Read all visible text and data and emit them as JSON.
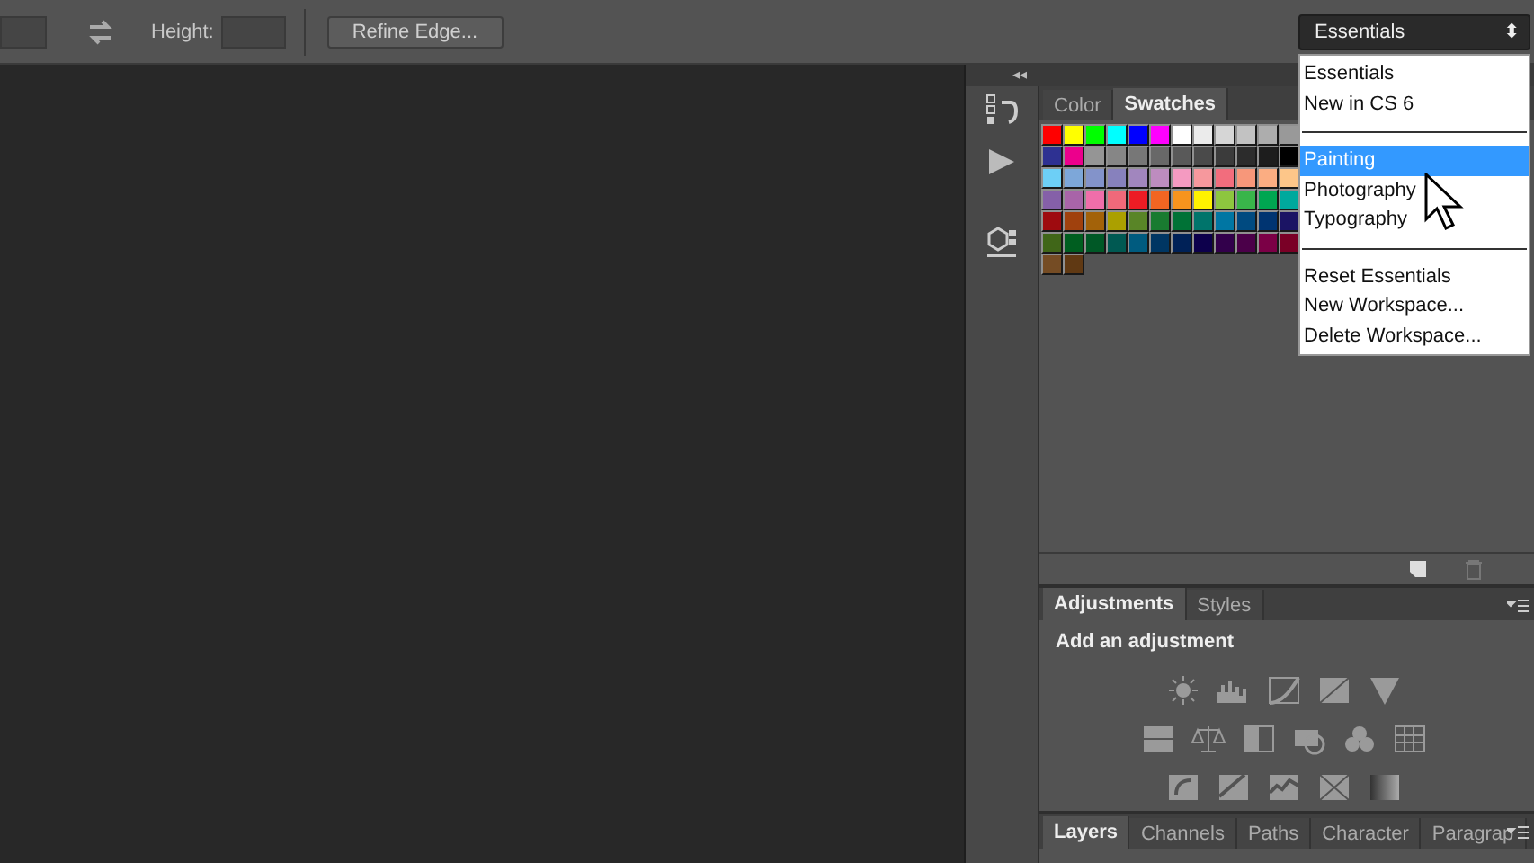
{
  "options_bar": {
    "height_label": "Height:",
    "refine_button": "Refine Edge...",
    "workspace_select": {
      "value": "Essentials",
      "arrow": "⬍"
    }
  },
  "dock": {
    "collapse": "◂◂"
  },
  "swatches_panel": {
    "tabs": [
      {
        "label": "Color",
        "selected": false
      },
      {
        "label": "Swatches",
        "selected": true
      }
    ],
    "rows": [
      {
        "swatches": [
          {
            "color": "#ff0000"
          },
          {
            "color": "#ffff00"
          },
          {
            "color": "#00ff00"
          },
          {
            "color": "#00ffff"
          },
          {
            "color": "#0000ff"
          },
          {
            "color": "#ff00ff"
          },
          {
            "color": "#ffffff"
          },
          {
            "color": "#ebebeb"
          },
          {
            "color": "#d6d6d6"
          },
          {
            "color": "#c2c2c2"
          },
          {
            "color": "#adadad"
          },
          {
            "color": "#999999"
          }
        ]
      },
      {
        "swatches": [
          {
            "color": "#2e3192"
          },
          {
            "color": "#ec008c"
          },
          {
            "color": "#959595"
          },
          {
            "color": "#868686"
          },
          {
            "color": "#777777"
          },
          {
            "color": "#686868"
          },
          {
            "color": "#595959"
          },
          {
            "color": "#4a4a4a"
          },
          {
            "color": "#3b3b3b"
          },
          {
            "color": "#2c2c2c"
          },
          {
            "color": "#1d1d1d"
          },
          {
            "color": "#000000"
          }
        ]
      },
      {
        "swatches": [
          {
            "color": "#6dcff6"
          },
          {
            "color": "#7da7d9"
          },
          {
            "color": "#8393ca"
          },
          {
            "color": "#8781bd"
          },
          {
            "color": "#a186be"
          },
          {
            "color": "#bd8cbf"
          },
          {
            "color": "#f49ac1"
          },
          {
            "color": "#f6989d"
          },
          {
            "color": "#f26d7d"
          },
          {
            "color": "#f7977a"
          },
          {
            "color": "#fbad82"
          },
          {
            "color": "#fdc689"
          }
        ]
      },
      {
        "swatches": [
          {
            "color": "#8560a8"
          },
          {
            "color": "#a864a8"
          },
          {
            "color": "#f06eaa"
          },
          {
            "color": "#f0697a"
          },
          {
            "color": "#ed1c24"
          },
          {
            "color": "#f26522"
          },
          {
            "color": "#f7941d"
          },
          {
            "color": "#fff200"
          },
          {
            "color": "#8dc63f"
          },
          {
            "color": "#39b54a"
          },
          {
            "color": "#00a651"
          },
          {
            "color": "#00a99d"
          }
        ]
      },
      {
        "swatches": [
          {
            "color": "#9e0b0f"
          },
          {
            "color": "#a0410d"
          },
          {
            "color": "#a36209"
          },
          {
            "color": "#aba000"
          },
          {
            "color": "#598527"
          },
          {
            "color": "#197b30"
          },
          {
            "color": "#007236"
          },
          {
            "color": "#00746b"
          },
          {
            "color": "#0076a3"
          },
          {
            "color": "#004a80"
          },
          {
            "color": "#003471"
          },
          {
            "color": "#1b1464"
          }
        ]
      },
      {
        "swatches": [
          {
            "color": "#406618"
          },
          {
            "color": "#005e20"
          },
          {
            "color": "#005826"
          },
          {
            "color": "#005952"
          },
          {
            "color": "#005b7f"
          },
          {
            "color": "#003663"
          },
          {
            "color": "#002157"
          },
          {
            "color": "#0d004c"
          },
          {
            "color": "#32004b"
          },
          {
            "color": "#4b0049"
          },
          {
            "color": "#7b0046"
          },
          {
            "color": "#7a0026"
          }
        ]
      },
      {
        "swatches": [
          {
            "color": "#754c24"
          },
          {
            "color": "#603913"
          }
        ]
      }
    ]
  },
  "adjustments_panel": {
    "tabs": [
      {
        "label": "Adjustments",
        "selected": true
      },
      {
        "label": "Styles",
        "selected": false
      }
    ],
    "heading": "Add an adjustment"
  },
  "layers_panel": {
    "tabs": [
      {
        "label": "Layers",
        "selected": true
      },
      {
        "label": "Channels",
        "selected": false
      },
      {
        "label": "Paths",
        "selected": false
      },
      {
        "label": "Character",
        "selected": false
      },
      {
        "label": "Paragrap",
        "selected": false
      }
    ]
  },
  "workspace_menu": {
    "groups": [
      {
        "items": [
          {
            "label": "Essentials",
            "selected": false
          },
          {
            "label": "New in CS 6",
            "selected": false
          }
        ]
      },
      {
        "items": [
          {
            "label": "Painting",
            "selected": true
          },
          {
            "label": "Photography",
            "selected": false
          },
          {
            "label": "Typography",
            "selected": false
          }
        ]
      },
      {
        "items": [
          {
            "label": "Reset Essentials",
            "selected": false
          },
          {
            "label": "New Workspace...",
            "selected": false
          },
          {
            "label": "Delete Workspace...",
            "selected": false
          }
        ]
      }
    ]
  }
}
